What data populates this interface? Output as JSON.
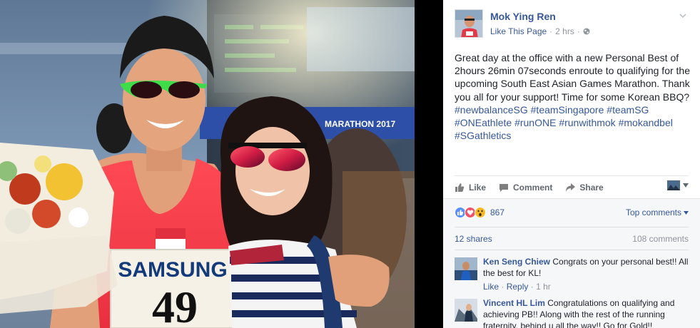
{
  "photo": {
    "bib_sponsor": "SAMSUNG",
    "bib_number": "49",
    "banner_text": "MARATHON 2017"
  },
  "post": {
    "author": "Mok Ying Ren",
    "like_page_label": "Like This Page",
    "separator": "·",
    "time": "2 hrs",
    "message_plain": "Great day at the office with a new Personal Best of 2hours 26min 07seconds enroute to qualifying for the upcoming South East Asian Games Marathon. Thank you all for your support! Time for some Korean BBQ?",
    "hashtags": [
      "#newbalanceSG",
      "#teamSingapore",
      "#teamSG",
      "#ONEathlete",
      "#runONE",
      "#runwithmok",
      "#mokandbel",
      "#SGathletics"
    ],
    "icons": {
      "audience": "globe-icon",
      "options": "chevron-down-icon"
    }
  },
  "actions": {
    "like": "Like",
    "comment": "Comment",
    "share": "Share"
  },
  "feedback": {
    "reactions": [
      "like",
      "love",
      "wow"
    ],
    "reaction_count": "867",
    "top_comments_label": "Top comments",
    "shares": "12 shares",
    "comments": "108 comments"
  },
  "comments": [
    {
      "author": "Ken Seng Chiew",
      "text": "Congrats on your personal best!! All the best for KL!",
      "like_label": "Like",
      "reply_label": "Reply",
      "separator": "·",
      "time": "1 hr"
    },
    {
      "author": "Vincent HL Lim",
      "text": "Congratulations on qualifying and achieving PB!! Along with the rest of the running fraternity, behind u all the way!! Go for Gold!!"
    }
  ],
  "colors": {
    "link": "#365899",
    "text": "#1d2129",
    "meta": "#90949c",
    "feedback_bg": "#f6f7f9",
    "like_blue": "#5890ff",
    "love_red": "#f25268",
    "wow_yellow": "#f7b928"
  }
}
